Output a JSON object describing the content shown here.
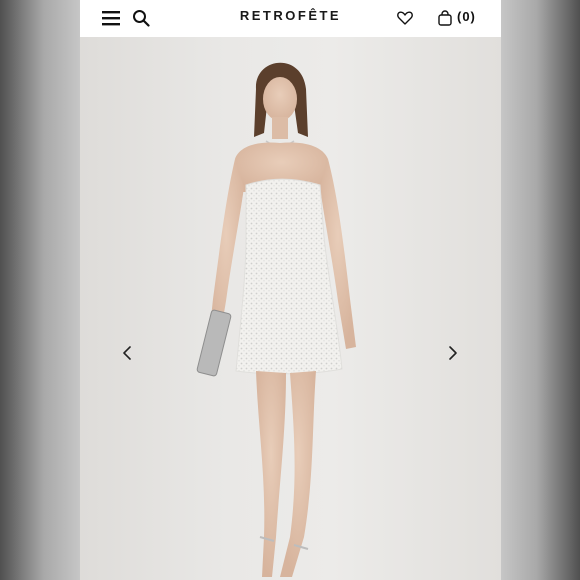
{
  "header": {
    "brand": "RETROFÊTE",
    "cart_count": "(0)",
    "icons": {
      "menu": "hamburger-menu-icon",
      "search": "search-icon",
      "wishlist": "heart-icon",
      "cart": "shopping-bag-icon"
    }
  },
  "gallery": {
    "icons": {
      "prev": "chevron-left-icon",
      "next": "chevron-right-icon"
    },
    "image": "model-in-white-sequin-strapless-mini-dress"
  },
  "colors": {
    "header_bg": "#ffffff",
    "text": "#111111",
    "photo_bg": "#e6e5e3",
    "dress": "#f3f2ef"
  }
}
